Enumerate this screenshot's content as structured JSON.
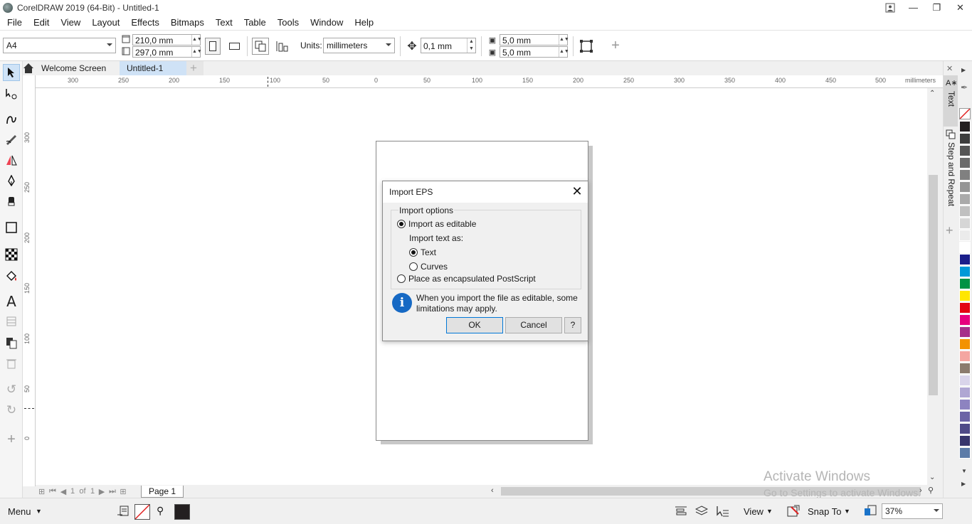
{
  "app": {
    "window_title": "CorelDRAW 2019 (64-Bit) - Untitled-1",
    "window_buttons": [
      "user-icon",
      "minimize",
      "restore",
      "close"
    ]
  },
  "menu": [
    "File",
    "Edit",
    "View",
    "Layout",
    "Effects",
    "Bitmaps",
    "Text",
    "Table",
    "Tools",
    "Window",
    "Help"
  ],
  "propbar": {
    "page_size": "A4",
    "width": "210,0 mm",
    "height": "297,0 mm",
    "units_label": "Units:",
    "units_value": "millimeters",
    "nudge": "0,1 mm",
    "dup_x": "5,0 mm",
    "dup_y": "5,0 mm"
  },
  "tabs": {
    "welcome": "Welcome Screen",
    "document": "Untitled-1"
  },
  "ruler": {
    "h_ticks": [
      "300",
      "250",
      "200",
      "150",
      "100",
      "50",
      "0",
      "50",
      "100",
      "150",
      "200",
      "250",
      "300",
      "350",
      "400",
      "450",
      "500"
    ],
    "h_unit": "millimeters",
    "v_ticks": [
      "300",
      "250",
      "200",
      "150",
      "100",
      "50",
      "0"
    ]
  },
  "dialog": {
    "title": "Import EPS",
    "group_label": "Import options",
    "opt_editable": "Import as editable",
    "import_text_as": "Import text as:",
    "opt_text": "Text",
    "opt_curves": "Curves",
    "opt_eps": "Place as encapsulated PostScript",
    "info": "When you import the file as editable, some limitations may apply.",
    "ok": "OK",
    "cancel": "Cancel",
    "help": "?",
    "selected_mode": "Import as editable",
    "selected_text_mode": "Text"
  },
  "dockers": {
    "text": "Text",
    "step_repeat": "Step and Repeat"
  },
  "page_nav": {
    "current": "1",
    "of": "of",
    "total": "1",
    "page_tab": "Page 1"
  },
  "statusbar": {
    "menu": "Menu",
    "view": "View",
    "snap_to": "Snap To",
    "zoom": "37%"
  },
  "watermark": {
    "line1": "Activate Windows",
    "line2": "Go to Settings to activate Windows."
  },
  "palette_colors": [
    "#231f20",
    "#3d3d3d",
    "#555555",
    "#6b6b6b",
    "#808080",
    "#959595",
    "#aaaaaa",
    "#c0c0c0",
    "#d6d6d6",
    "#ebebeb",
    "#ffffff",
    "#1b1f8a",
    "#0099d8",
    "#009245",
    "#ffe600",
    "#e30613",
    "#e6007e",
    "#a5308a",
    "#f39200",
    "#f4a6a1",
    "#8b7b6e",
    "#d9d4ea",
    "#b0a7d3",
    "#8d83c0",
    "#6c63a6",
    "#4f4a88",
    "#38366d",
    "#5d7ca8"
  ]
}
